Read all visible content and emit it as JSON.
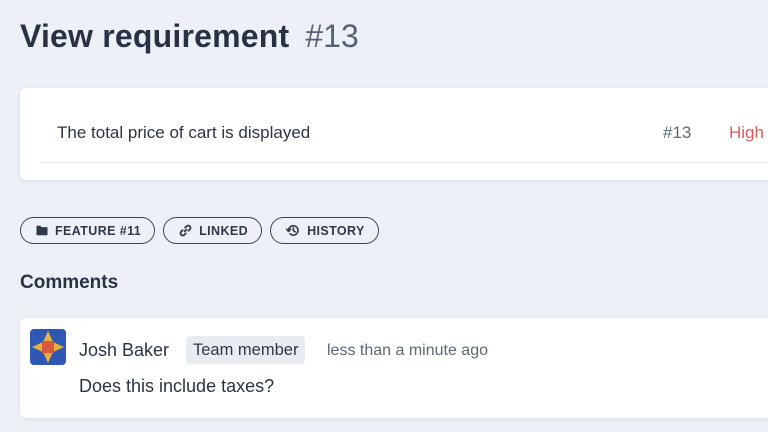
{
  "header": {
    "title": "View requirement",
    "id": "#13"
  },
  "requirement": {
    "text": "The total price of cart is displayed",
    "id": "#13",
    "priority": "High"
  },
  "chips": [
    {
      "label": "FEATURE #11",
      "icon": "folder-icon"
    },
    {
      "label": "LINKED",
      "icon": "link-icon"
    },
    {
      "label": "HISTORY",
      "icon": "history-icon"
    }
  ],
  "comments": {
    "heading": "Comments",
    "items": [
      {
        "author": "Josh Baker",
        "role": "Team member",
        "time": "less than a minute ago",
        "body": "Does this include taxes?"
      }
    ]
  },
  "colors": {
    "background": "#edf1f7",
    "priority_high": "#e05a5a",
    "avatar_blue": "#2f57b4",
    "avatar_gold": "#e8b23a",
    "avatar_red": "#d9573f"
  }
}
